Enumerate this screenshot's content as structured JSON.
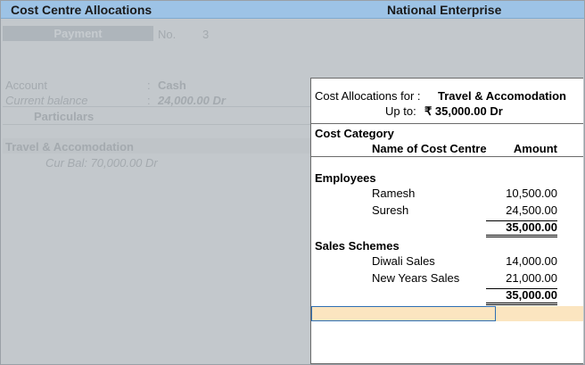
{
  "title": "Cost Centre Allocations",
  "company": "National Enterprise",
  "voucher": {
    "type": "Payment",
    "no_label": "No.",
    "no": "3"
  },
  "account": {
    "label": "Account",
    "value": "Cash",
    "balance_label": "Current balance",
    "balance": "24,000.00 Dr",
    "separator": ":"
  },
  "particulars_header": "Particulars",
  "entry": {
    "ledger": "Travel & Accomodation",
    "cur_bal": "Cur Bal: 70,000.00 Dr"
  },
  "panel": {
    "for_label": "Cost Allocations for :",
    "ledger": "Travel & Accomodation",
    "upto_label": "Up to:",
    "upto_value": "₹ 35,000.00 Dr",
    "category_header": "Cost Category",
    "name_header": "Name of Cost Centre",
    "amount_header": "Amount",
    "categories": [
      {
        "name": "Employees",
        "items": [
          {
            "name": "Ramesh",
            "amount": "10,500.00"
          },
          {
            "name": "Suresh",
            "amount": "24,500.00"
          }
        ],
        "total": "35,000.00"
      },
      {
        "name": "Sales Schemes",
        "items": [
          {
            "name": "Diwali Sales",
            "amount": "14,000.00"
          },
          {
            "name": "New Years Sales",
            "amount": "21,000.00"
          }
        ],
        "total": "35,000.00"
      }
    ],
    "input_value": ""
  },
  "colors": {
    "titlebar": "#9dc3e6",
    "background": "#c3c8cc",
    "panel": "#ffffff",
    "input_highlight": "#fbe5c0",
    "focus_border": "#2f6fb3"
  }
}
